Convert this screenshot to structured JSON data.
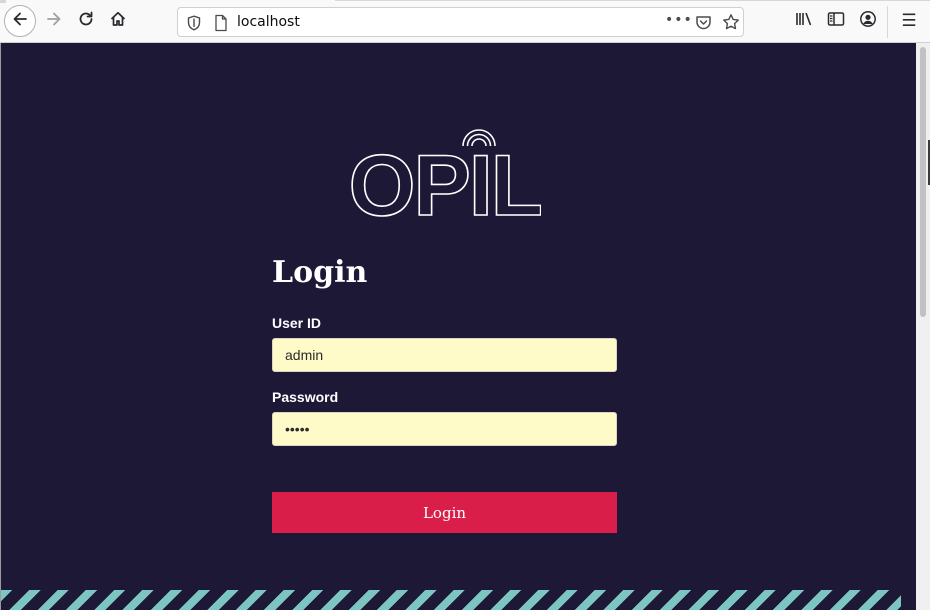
{
  "browser": {
    "url": "localhost",
    "more_label": "•••",
    "menu_label": "☰",
    "icons": [
      "back-arrow-icon",
      "forward-arrow-icon",
      "reload-icon",
      "home-icon",
      "shield-icon",
      "page-icon",
      "more-icon",
      "pocket-icon",
      "bookmark-star-icon",
      "library-icon",
      "sidebar-icon",
      "account-icon",
      "menu-icon"
    ]
  },
  "page": {
    "logo_text": "OPIL",
    "title": "Login",
    "user_id": {
      "label": "User ID",
      "value": "admin"
    },
    "password": {
      "label": "Password",
      "value": "admin"
    },
    "submit_label": "Login"
  },
  "colors": {
    "page_background": "#1c1836",
    "button": "#d91e4a",
    "input_background": "#fefbc9",
    "stripe": "#7cc5c3"
  }
}
